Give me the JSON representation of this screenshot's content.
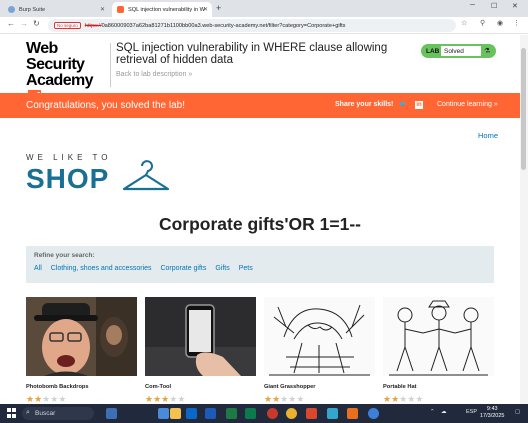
{
  "browser": {
    "tabs": [
      {
        "label": "Burp Suite",
        "active": false
      },
      {
        "label": "SQL injection vulnerability in W",
        "active": true
      }
    ],
    "url_badge": "No seguro",
    "url_scheme": "https://",
    "url_rest": "0a860009037a62ba81271b1100bb00a3.web-security-academy.net/filter?category=Corporate+gifts"
  },
  "lab": {
    "logo_line1": "Web Security",
    "logo_line2": "Academy",
    "title": "SQL injection vulnerability in WHERE clause allowing retrieval of hidden data",
    "back_link": "Back to lab description »",
    "status_tag": "LAB",
    "status_value": "Solved"
  },
  "banner": {
    "message": "Congratulations, you solved the lab!",
    "share": "Share your skills!",
    "continue": "Continue learning »"
  },
  "nav": {
    "home": "Home"
  },
  "shop": {
    "tagline": "WE LIKE TO",
    "word": "SHOP"
  },
  "page_title": "Corporate gifts'OR 1=1--",
  "filter": {
    "label": "Refine your search:",
    "categories": [
      "All",
      "Clothing, shoes and accessories",
      "Corporate gifts",
      "Gifts",
      "Pets"
    ]
  },
  "products": [
    {
      "name": "Photobomb Backdrops",
      "rating": 2
    },
    {
      "name": "Com-Tool",
      "rating": 3
    },
    {
      "name": "Giant Grasshopper",
      "rating": 2
    },
    {
      "name": "Portable Hat",
      "rating": 2
    }
  ],
  "taskbar": {
    "search": "Buscar",
    "lang": "ESP",
    "time": "9:43",
    "date": "17/3/2025"
  },
  "colors": {
    "accent": "#ff6633",
    "link": "#0074b3",
    "solved": "#68c35f",
    "shop_blue": "#1a6f93"
  }
}
